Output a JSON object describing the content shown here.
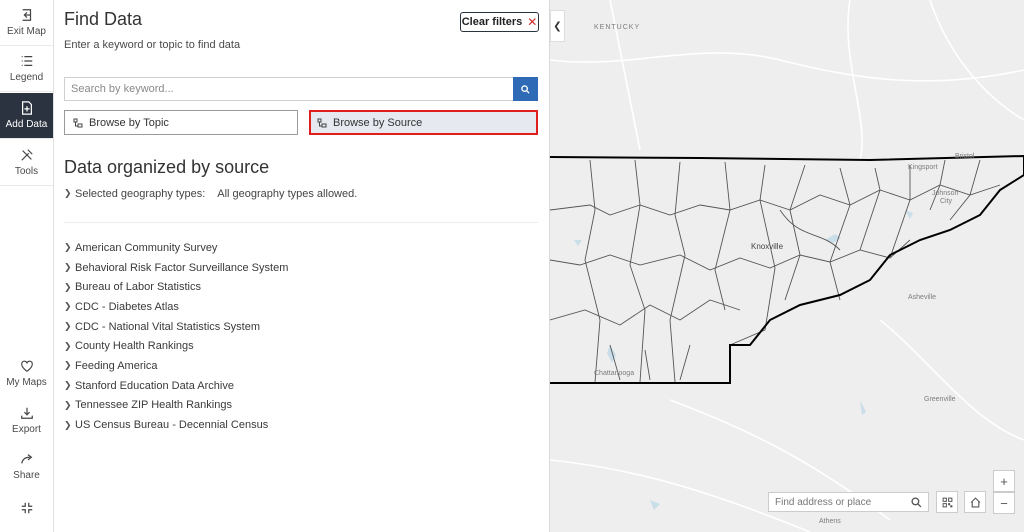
{
  "rail": {
    "items": [
      {
        "label": "Exit Map",
        "icon": "exit-icon"
      },
      {
        "label": "Legend",
        "icon": "list-icon"
      },
      {
        "label": "Add Data",
        "icon": "add-data-icon",
        "active": true
      },
      {
        "label": "Tools",
        "icon": "tools-icon"
      }
    ],
    "bottom": [
      {
        "label": "My Maps",
        "icon": "heart-icon"
      },
      {
        "label": "Export",
        "icon": "download-icon"
      },
      {
        "label": "Share",
        "icon": "share-icon"
      }
    ]
  },
  "panel": {
    "title": "Find Data",
    "subtitle": "Enter a keyword or topic to find data",
    "clear_label": "Clear filters",
    "search_placeholder": "Search by keyword...",
    "browse_topic": "Browse by Topic",
    "browse_source": "Browse by Source",
    "section_title": "Data organized by source",
    "geo_label": "Selected geography types:",
    "geo_value": "All geography types allowed.",
    "sources": [
      "American Community Survey",
      "Behavioral Risk Factor Surveillance System",
      "Bureau of Labor Statistics",
      "CDC - Diabetes Atlas",
      "CDC - National Vital Statistics System",
      "County Health Rankings",
      "Feeding America",
      "Stanford Education Data Archive",
      "Tennessee ZIP Health Rankings",
      "US Census Bureau - Decennial Census"
    ]
  },
  "map": {
    "labels": {
      "kentucky": "KENTUCKY",
      "bristol": "Bristol",
      "kingsport": "Kingsport",
      "johnson": "Johnson",
      "city": "City",
      "knoxville": "Knoxville",
      "asheville": "Asheville",
      "chattanooga": "Chattanooga",
      "greenville": "Greenville",
      "athens": "Athens"
    },
    "search_placeholder": "Find address or place",
    "zoom_in": "+",
    "zoom_out": "−",
    "state_border_color": "#000000",
    "county_color": "#555555",
    "water_color": "#c9dee8"
  }
}
